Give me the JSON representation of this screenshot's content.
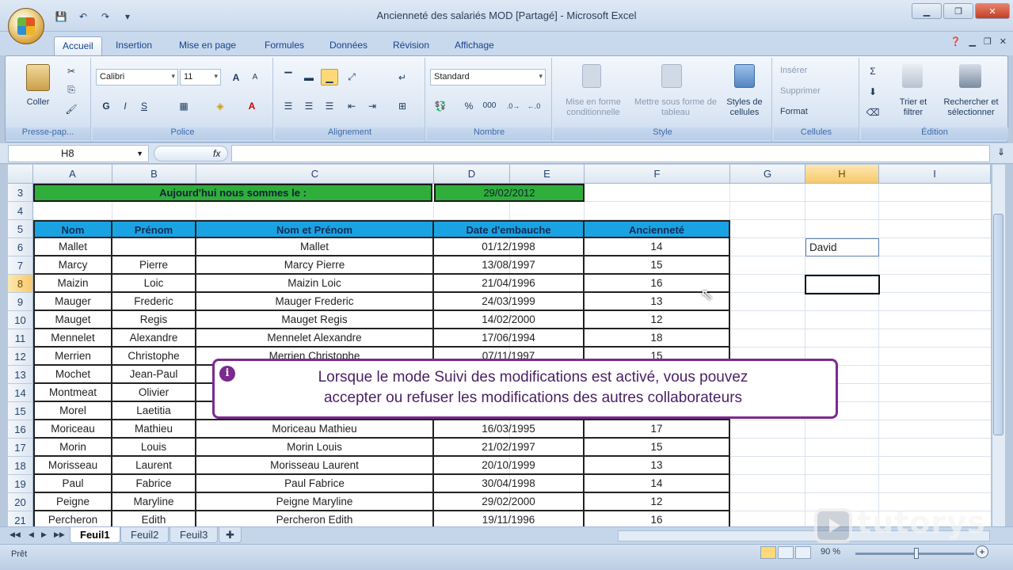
{
  "window": {
    "title": "Ancienneté des salariés MOD  [Partagé] - Microsoft Excel"
  },
  "tabs": [
    "Accueil",
    "Insertion",
    "Mise en page",
    "Formules",
    "Données",
    "Révision",
    "Affichage"
  ],
  "ribbon": {
    "presse_papiers": {
      "label": "Presse-pap...",
      "coller": "Coller"
    },
    "police": {
      "label": "Police",
      "font": "Calibri",
      "size": "11",
      "bold": "G",
      "italic": "I",
      "underline": "S"
    },
    "alignement": {
      "label": "Alignement"
    },
    "nombre": {
      "label": "Nombre",
      "format": "Standard",
      "percent": "%",
      "thousands": "000"
    },
    "style": {
      "label": "Style",
      "mise_en_forme": "Mise en forme conditionnelle",
      "mettre_sous_forme": "Mettre sous forme de tableau",
      "styles_cellules": "Styles de cellules"
    },
    "cellules": {
      "label": "Cellules",
      "inserer": "Insérer",
      "supprimer": "Supprimer",
      "format": "Format"
    },
    "edition": {
      "label": "Édition",
      "trier": "Trier et filtrer",
      "rechercher": "Rechercher et sélectionner"
    }
  },
  "formula_bar": {
    "name_box": "H8",
    "fx": "fx",
    "value": ""
  },
  "columns": [
    "A",
    "B",
    "C",
    "D",
    "E",
    "F",
    "G",
    "H",
    "I"
  ],
  "selected_column": "H",
  "selected_row": "8",
  "row_numbers": [
    "3",
    "4",
    "5",
    "6",
    "7",
    "8",
    "9",
    "10",
    "11",
    "12",
    "13",
    "14",
    "15",
    "16",
    "17",
    "18",
    "19",
    "20",
    "21"
  ],
  "banner": {
    "label": "Aujourd'hui nous sommes le :",
    "date": "29/02/2012"
  },
  "table": {
    "headers": [
      "Nom",
      "Prénom",
      "Nom et Prénom",
      "Date d'embauche",
      "Ancienneté"
    ],
    "rows": [
      [
        "Mallet",
        "",
        "Mallet",
        "01/12/1998",
        "14"
      ],
      [
        "Marcy",
        "Pierre",
        "Marcy Pierre",
        "13/08/1997",
        "15"
      ],
      [
        "Maizin",
        "Loic",
        "Maizin Loic",
        "21/04/1996",
        "16"
      ],
      [
        "Mauger",
        "Frederic",
        "Mauger Frederic",
        "24/03/1999",
        "13"
      ],
      [
        "Mauget",
        "Regis",
        "Mauget Regis",
        "14/02/2000",
        "12"
      ],
      [
        "Mennelet",
        "Alexandre",
        "Mennelet Alexandre",
        "17/06/1994",
        "18"
      ],
      [
        "Merrien",
        "Christophe",
        "Merrien Christophe",
        "07/11/1997",
        "15"
      ],
      [
        "Mochet",
        "Jean-Paul",
        "",
        "",
        ""
      ],
      [
        "Montmeat",
        "Olivier",
        "",
        "",
        ""
      ],
      [
        "Morel",
        "Laetitia",
        "",
        "",
        ""
      ],
      [
        "Moriceau",
        "Mathieu",
        "Moriceau Mathieu",
        "16/03/1995",
        "17"
      ],
      [
        "Morin",
        "Louis",
        "Morin Louis",
        "21/02/1997",
        "15"
      ],
      [
        "Morisseau",
        "Laurent",
        "Morisseau Laurent",
        "20/10/1999",
        "13"
      ],
      [
        "Paul",
        "Fabrice",
        "Paul Fabrice",
        "30/04/1998",
        "14"
      ],
      [
        "Peigne",
        "Maryline",
        "Peigne Maryline",
        "29/02/2000",
        "12"
      ],
      [
        "Percheron",
        "Edith",
        "Percheron Edith",
        "19/11/1996",
        "16"
      ]
    ]
  },
  "h6_value": "David",
  "tooltip": {
    "icon": "i",
    "line1": "Lorsque le mode Suivi des modifications est activé, vous pouvez",
    "line2": "accepter ou refuser les modifications des autres collaborateurs"
  },
  "sheet_tabs": [
    "Feuil1",
    "Feuil2",
    "Feuil3"
  ],
  "status": {
    "ready": "Prêt",
    "zoom": "90 %"
  },
  "watermark": "tutorys"
}
